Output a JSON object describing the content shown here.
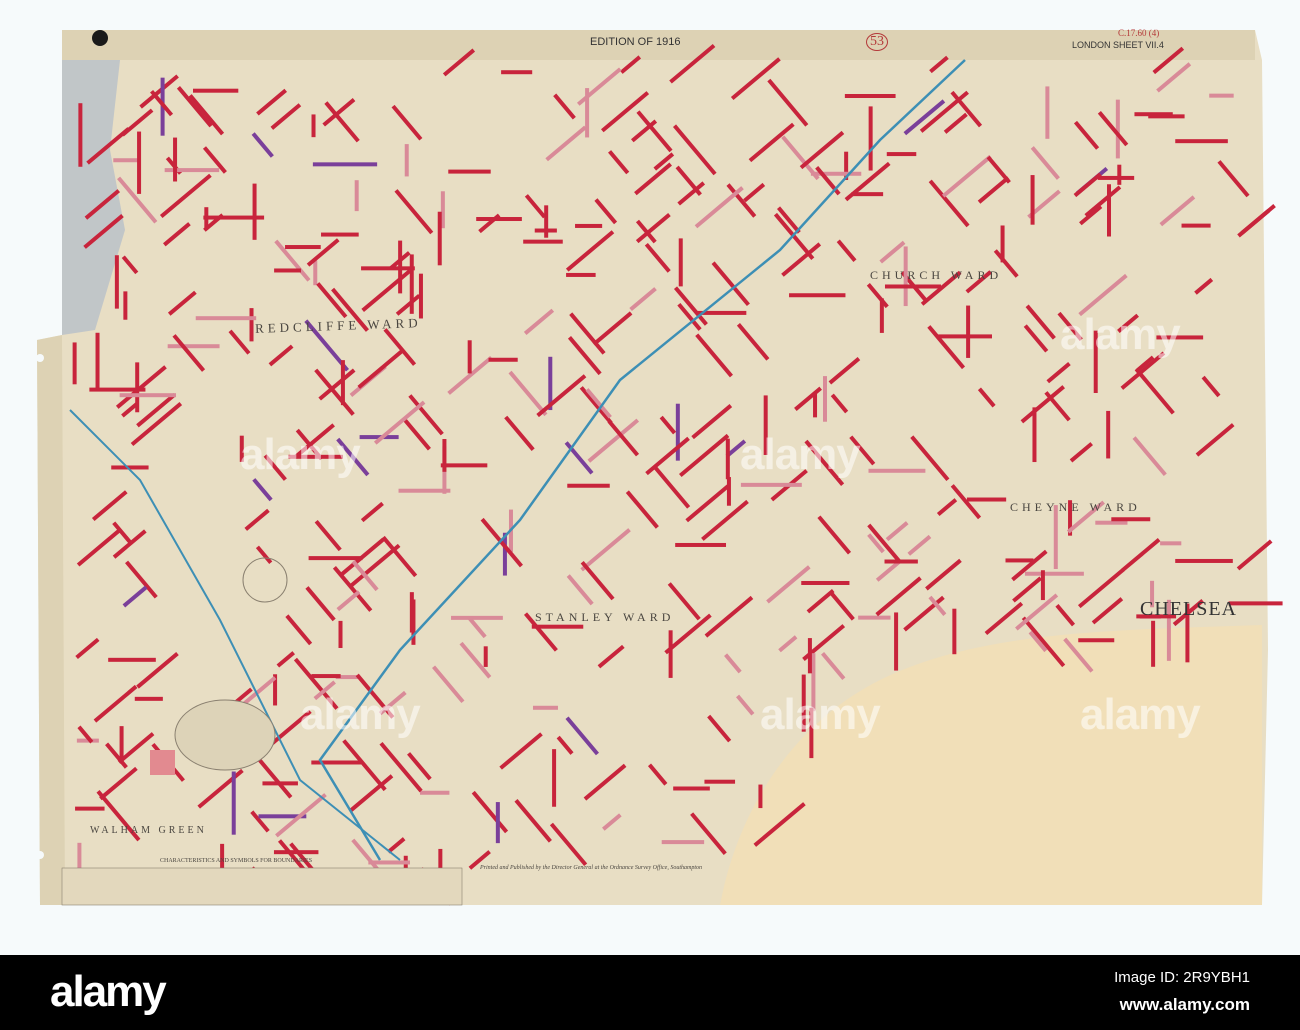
{
  "header": {
    "edition": "EDITION OF 1916",
    "sheet_number": "53",
    "sheet_title": "LONDON SHEET VII.4",
    "archive_mark": "C.17.60 (4)"
  },
  "map": {
    "ward_labels": [
      "REDCLIFFE WARD",
      "CHURCH WARD",
      "CHEYNE WARD",
      "STANLEY WARD"
    ],
    "place_labels": [
      "CHELSEA",
      "WALHAM GREEN"
    ],
    "legend_title": "CHARACTERISTICS AND SYMBOLS FOR BOUNDARIES",
    "imprint": "Printed and Published by the Director General at the Ordnance Survey Office, Southampton",
    "colors": {
      "paper": "#e9dfc6",
      "street_red": "#c8243c",
      "street_pink": "#d98a98",
      "street_purple": "#7a3f9a",
      "river": "#3d8fb5",
      "thames": "#f1dfb8"
    }
  },
  "watermark": {
    "logo": "alamy",
    "image_id": "Image ID: 2R9YBH1",
    "url": "www.alamy.com"
  }
}
